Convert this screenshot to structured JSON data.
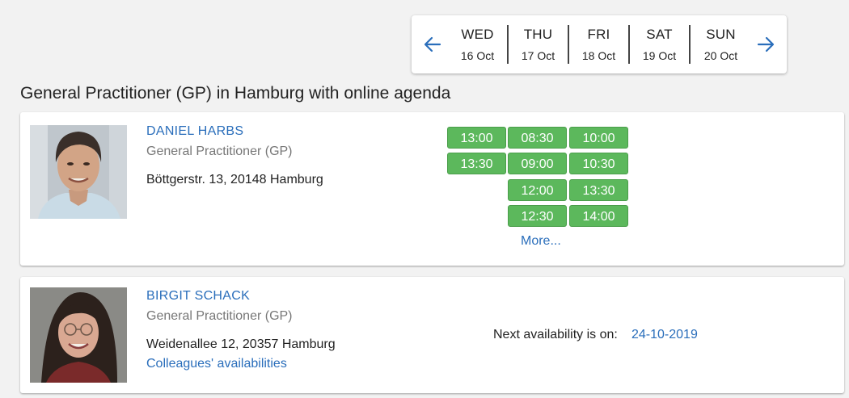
{
  "date_nav": {
    "prev_icon": "arrow-left-icon",
    "next_icon": "arrow-right-icon",
    "accent_color": "#2a6ebb",
    "days": [
      {
        "name": "WED",
        "date": "16 Oct"
      },
      {
        "name": "THU",
        "date": "17 Oct"
      },
      {
        "name": "FRI",
        "date": "18 Oct"
      },
      {
        "name": "SAT",
        "date": "19 Oct"
      },
      {
        "name": "SUN",
        "date": "20 Oct"
      }
    ]
  },
  "page_title": "General Practitioner (GP) in Hamburg with online agenda",
  "doctors": [
    {
      "name": "DANIEL HARBS",
      "specialty": "General Practitioner (GP)",
      "address": "Böttgerstr. 13, 20148 Hamburg",
      "slots": {
        "wed": [
          "13:00",
          "13:30"
        ],
        "thu": [
          "08:30",
          "09:00",
          "12:00",
          "12:30"
        ],
        "fri": [
          "10:00",
          "10:30",
          "13:30",
          "14:00"
        ]
      },
      "more_label": "More..."
    },
    {
      "name": "BIRGIT SCHACK",
      "specialty": "General Practitioner (GP)",
      "address": "Weidenallee 12, 20357 Hamburg",
      "colleagues_label": "Colleagues' availabilities",
      "next_availability_label": "Next availability is on:",
      "next_availability_date": "24-10-2019"
    }
  ],
  "colors": {
    "slot_green": "#5cb85c",
    "link_blue": "#2a6ebb",
    "background": "#f2f2f2"
  }
}
